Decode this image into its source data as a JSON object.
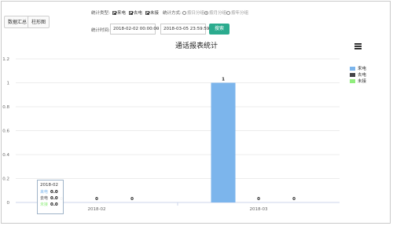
{
  "buttons": {
    "data_summary": "数据汇总",
    "column_chart": "柱形图"
  },
  "filters": {
    "type_label": "统计类型:",
    "types": [
      {
        "label": "来电",
        "checked": true
      },
      {
        "label": "去电",
        "checked": true
      },
      {
        "label": "未接",
        "checked": true
      }
    ],
    "method_label": "统计方式:",
    "methods": [
      {
        "label": "按日分组",
        "selected": false
      },
      {
        "label": "按月分组",
        "selected": true
      },
      {
        "label": "按年分组",
        "selected": false
      }
    ],
    "time_label": "统计时间:",
    "start_time": "2018-02-02 00:00:00",
    "separator": "-",
    "end_time": "2018-03-05 23:59:59",
    "search": "搜索"
  },
  "chart_title": "通话报表统计",
  "chart_data": {
    "type": "bar",
    "title": "通话报表统计",
    "categories": [
      "2018-02",
      "2018-03"
    ],
    "series": [
      {
        "name": "来电",
        "values": [
          0,
          1
        ],
        "color": "#7cb5ec"
      },
      {
        "name": "去电",
        "values": [
          0,
          0
        ],
        "color": "#434348"
      },
      {
        "name": "未接",
        "values": [
          0,
          0
        ],
        "color": "#90ed7d"
      }
    ],
    "ylim": [
      0,
      1.2
    ],
    "yticks": [
      "0",
      "0.2",
      "0.4",
      "0.6",
      "0.8",
      "1",
      "1.2"
    ],
    "data_labels": true,
    "grid": true,
    "legend_position": "right"
  },
  "tooltip": {
    "date": "2018-02",
    "rows": [
      {
        "name": "来电",
        "value": "0.0",
        "color": "#7cb5ec"
      },
      {
        "name": "去电",
        "value": "0.0",
        "color": "#434348"
      },
      {
        "name": "未接",
        "value": "0.0",
        "color": "#90ed7d"
      }
    ]
  },
  "icons": {
    "menu": "hamburger-menu-icon"
  }
}
